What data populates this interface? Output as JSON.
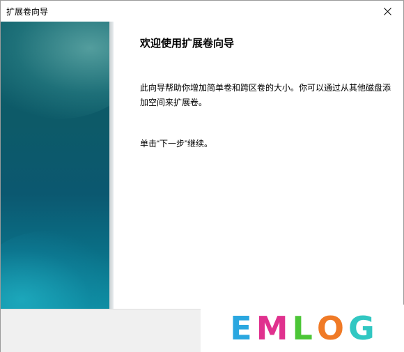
{
  "window": {
    "title": "扩展卷向导",
    "close_icon": "close-icon"
  },
  "wizard": {
    "heading": "欢迎使用扩展卷向导",
    "description": "此向导帮助你增加简单卷和跨区卷的大小。你可以通过从其他磁盘添加空间来扩展卷。",
    "instruction": "单击“下一步”继续。"
  },
  "watermark": {
    "letters": [
      "E",
      "M",
      "L",
      "O",
      "G"
    ],
    "colors": [
      "#2aa7e0",
      "#e0318e",
      "#4cc637",
      "#f07a26",
      "#31c7c2"
    ]
  }
}
